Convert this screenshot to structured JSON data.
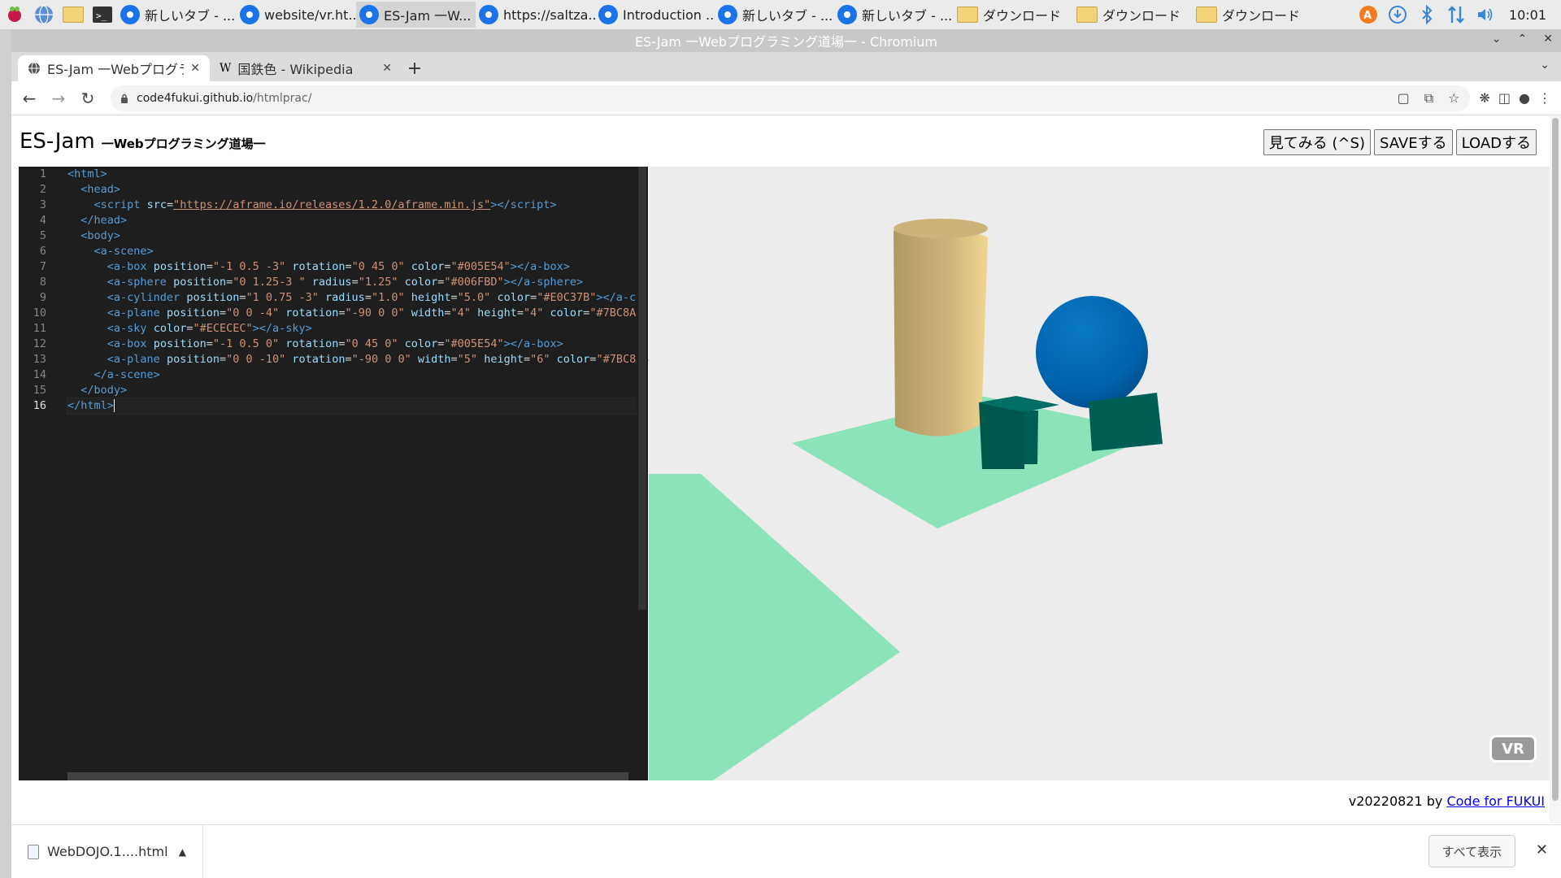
{
  "taskbar": {
    "tasks": [
      {
        "label": "新しいタブ - ..."
      },
      {
        "label": "website/vr.ht..."
      },
      {
        "label": "ES-Jam 一W..."
      },
      {
        "label": "https://saltza..."
      },
      {
        "label": "Introduction ..."
      },
      {
        "label": "新しいタブ - ..."
      },
      {
        "label": "新しいタブ - ..."
      }
    ],
    "folders": [
      {
        "label": "ダウンロード"
      },
      {
        "label": "ダウンロード"
      },
      {
        "label": "ダウンロード"
      }
    ],
    "clock": "10:01"
  },
  "window": {
    "title": "ES-Jam 一Webプログラミング道場一 - Chromium"
  },
  "tabs": [
    {
      "label": "ES-Jam 一Webプログラ",
      "icon": "globe-icon"
    },
    {
      "label": "国鉄色 - Wikipedia",
      "icon": "wikipedia-icon"
    }
  ],
  "address": {
    "host": "code4fukui.github.io",
    "path": "/htmlprac/"
  },
  "app": {
    "title": "ES-Jam",
    "subtitle": "一Webプログラミング道場一",
    "buttons": {
      "view": "見てみる (^S)",
      "save": "SAVEする",
      "load": "LOADする"
    },
    "vr_label": "VR",
    "footer_version": "v20220821 by ",
    "footer_link": "Code for FUKUI"
  },
  "editor": {
    "line_numbers": [
      "1",
      "2",
      "3",
      "4",
      "5",
      "6",
      "7",
      "8",
      "9",
      "10",
      "11",
      "12",
      "13",
      "14",
      "15",
      "16"
    ]
  },
  "scene_colors": {
    "box": "#005E54",
    "sphere": "#006FBD",
    "cylinder": "#E0C37B",
    "plane": "#7BC8A4",
    "sky": "#ECECEC"
  },
  "downloads": {
    "file": "WebDOJO.1....html",
    "show_all": "すべて表示"
  }
}
